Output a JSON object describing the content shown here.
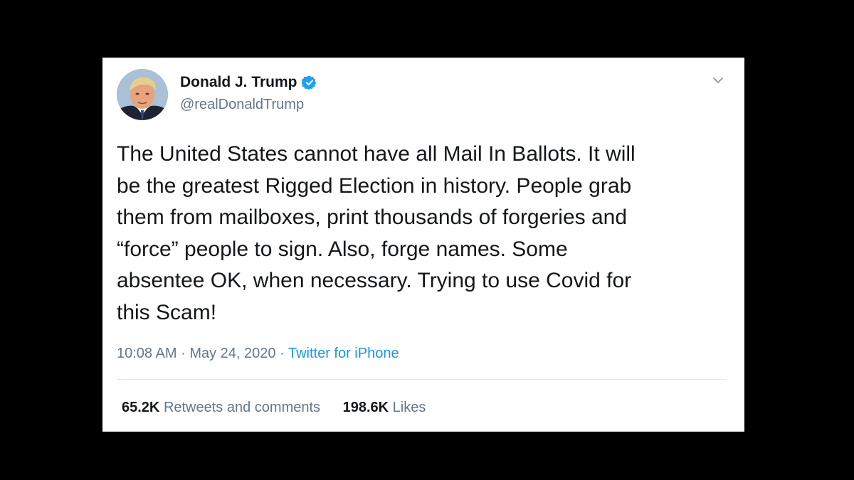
{
  "tweet": {
    "author": {
      "display_name": "Donald J. Trump",
      "handle": "@realDonaldTrump",
      "verified_icon": "verified-badge-icon"
    },
    "text": "The United States cannot have all Mail In Ballots. It will\nbe the greatest Rigged Election in history. People grab\nthem from mailboxes, print thousands of forgeries and\n“force” people to sign. Also, forge names. Some\nabsentee OK, when necessary. Trying to use Covid for\nthis Scam!",
    "time": "10:08 AM",
    "separator": "·",
    "date": "May 24, 2020",
    "source": "Twitter for iPhone",
    "stats": {
      "retweets_count": "65.2K",
      "retweets_label": "Retweets and comments",
      "likes_count": "198.6K",
      "likes_label": "Likes"
    },
    "menu_icon": "chevron-down-icon"
  },
  "colors": {
    "background": "#000000",
    "card": "#ffffff",
    "text": "#14171a",
    "secondary": "#657786",
    "link": "#1b95e0",
    "verified": "#1da1f2",
    "divider": "#e1e8ed"
  }
}
